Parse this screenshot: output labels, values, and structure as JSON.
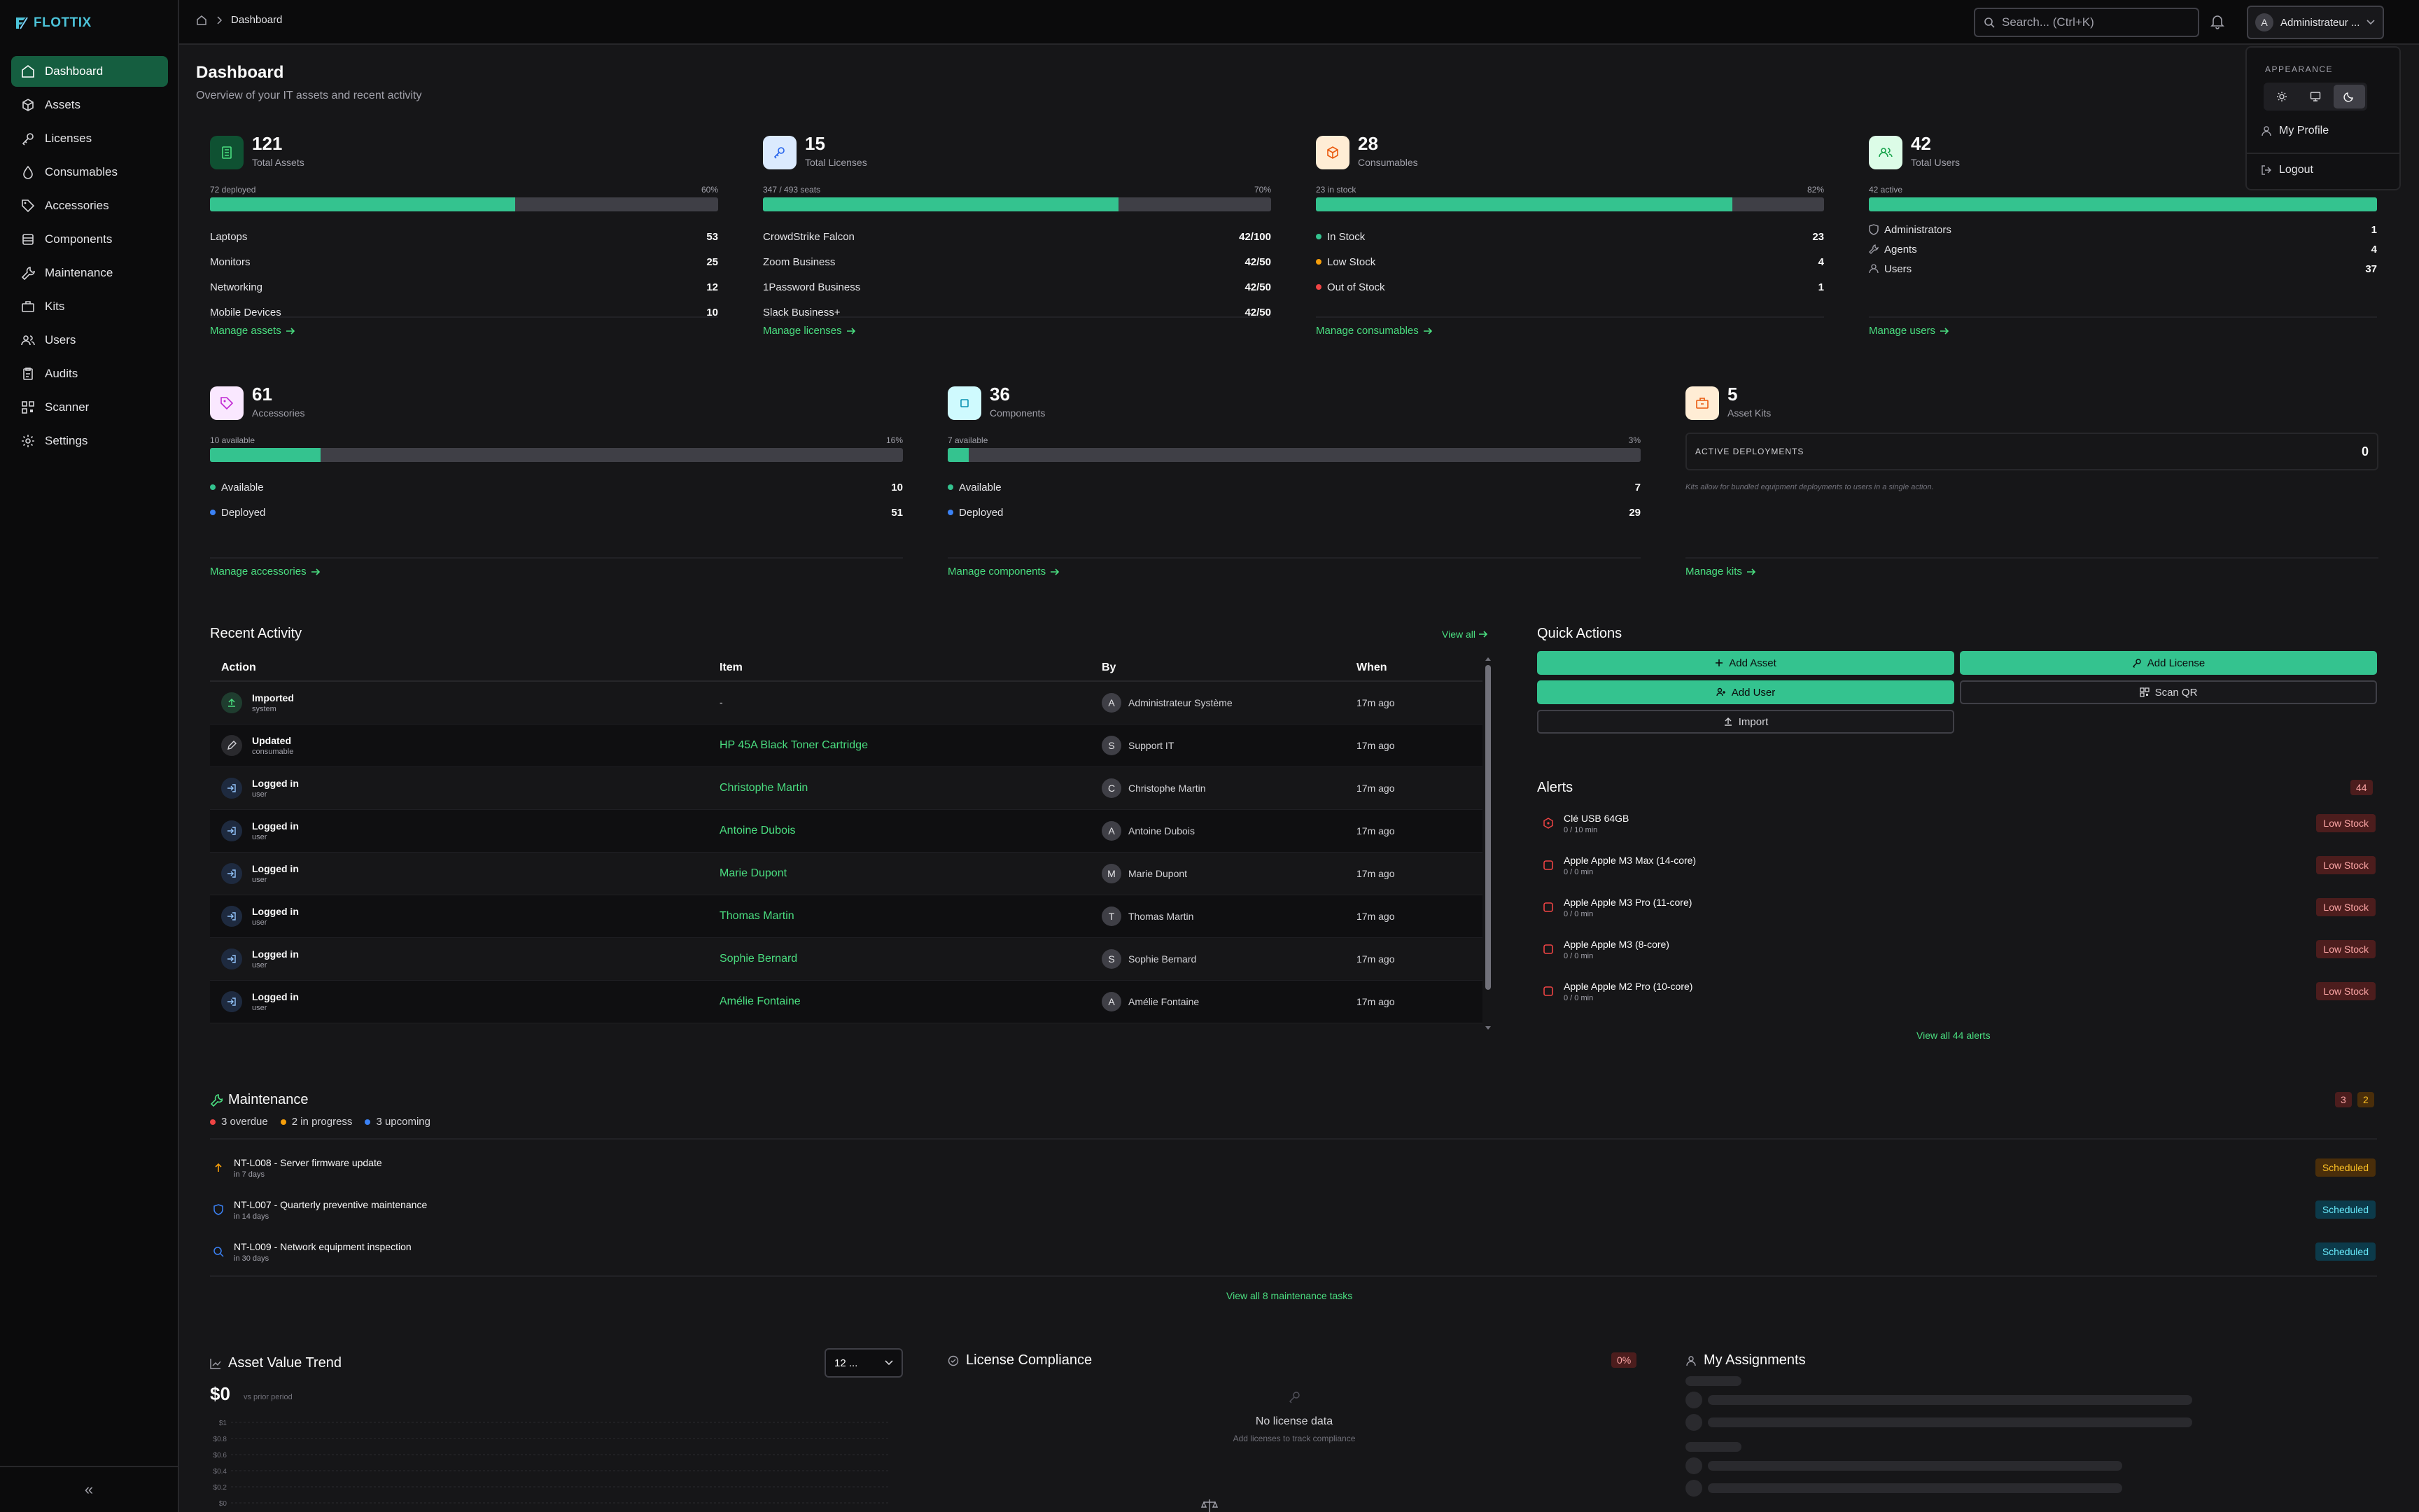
{
  "app": {
    "name": "FLOTTIX",
    "brand_color": "#34c38f",
    "accent_text": "#4ade80"
  },
  "sidebar": {
    "items": [
      {
        "label": "Dashboard",
        "icon": "home-icon",
        "active": true
      },
      {
        "label": "Assets",
        "icon": "box-icon"
      },
      {
        "label": "Licenses",
        "icon": "key-icon"
      },
      {
        "label": "Consumables",
        "icon": "droplet-icon"
      },
      {
        "label": "Accessories",
        "icon": "tag-icon"
      },
      {
        "label": "Components",
        "icon": "chip-icon"
      },
      {
        "label": "Maintenance",
        "icon": "wrench-icon"
      },
      {
        "label": "Kits",
        "icon": "kit-icon"
      },
      {
        "label": "Users",
        "icon": "users-icon"
      },
      {
        "label": "Audits",
        "icon": "clipboard-icon"
      },
      {
        "label": "Scanner",
        "icon": "scan-icon"
      },
      {
        "label": "Settings",
        "icon": "gear-icon"
      }
    ],
    "collapse_label": "«"
  },
  "topbar": {
    "breadcrumb": "Dashboard",
    "search_placeholder": "Search... (Ctrl+K)",
    "user_initial": "A",
    "user_name": "Administrateur ..."
  },
  "user_menu": {
    "appearance_label": "APPEARANCE",
    "theme_options": [
      "light",
      "system",
      "dark"
    ],
    "selected_theme": "dark",
    "profile_label": "My Profile",
    "logout_label": "Logout"
  },
  "page": {
    "title": "Dashboard",
    "subtitle": "Overview of your IT assets and recent activity"
  },
  "stats": {
    "assets": {
      "count": "121",
      "label": "Total Assets",
      "bar_left": "72 deployed",
      "bar_right": "60%",
      "fill": 0.6,
      "rows": [
        {
          "label": "Laptops",
          "value": "53"
        },
        {
          "label": "Monitors",
          "value": "25"
        },
        {
          "label": "Networking",
          "value": "12"
        },
        {
          "label": "Mobile Devices",
          "value": "10"
        }
      ],
      "link": "Manage assets"
    },
    "licenses": {
      "count": "15",
      "label": "Total Licenses",
      "bar_left": "347 / 493 seats",
      "bar_right": "70%",
      "fill": 0.7,
      "rows": [
        {
          "label": "CrowdStrike Falcon",
          "value": "42/100"
        },
        {
          "label": "Zoom Business",
          "value": "42/50"
        },
        {
          "label": "1Password Business",
          "value": "42/50"
        },
        {
          "label": "Slack Business+",
          "value": "42/50"
        }
      ],
      "link": "Manage licenses"
    },
    "consumables": {
      "count": "28",
      "label": "Consumables",
      "bar_left": "23 in stock",
      "bar_right": "82%",
      "fill": 0.82,
      "rows": [
        {
          "label": "In Stock",
          "value": "23",
          "dot": "#34c38f"
        },
        {
          "label": "Low Stock",
          "value": "4",
          "dot": "#f59e0b"
        },
        {
          "label": "Out of Stock",
          "value": "1",
          "dot": "#ef4444"
        }
      ],
      "link": "Manage consumables"
    },
    "users": {
      "count": "42",
      "label": "Total Users",
      "bar_left": "42 active",
      "bar_right": "",
      "fill": 1.0,
      "rows": [
        {
          "label": "Administrators",
          "value": "1"
        },
        {
          "label": "Agents",
          "value": "4"
        },
        {
          "label": "Users",
          "value": "37"
        }
      ],
      "link": "Manage users"
    },
    "accessories": {
      "count": "61",
      "label": "Accessories",
      "bar_left": "10 available",
      "bar_right": "16%",
      "fill": 0.16,
      "rows": [
        {
          "label": "Available",
          "value": "10",
          "dot": "#34c38f"
        },
        {
          "label": "Deployed",
          "value": "51",
          "dot": "#3b82f6"
        }
      ],
      "link": "Manage accessories"
    },
    "components": {
      "count": "36",
      "label": "Components",
      "bar_left": "7 available",
      "bar_right": "3%",
      "fill": 0.03,
      "rows": [
        {
          "label": "Available",
          "value": "7",
          "dot": "#34c38f"
        },
        {
          "label": "Deployed",
          "value": "29",
          "dot": "#3b82f6"
        }
      ],
      "link": "Manage components"
    },
    "kits": {
      "count": "5",
      "label": "Asset Kits",
      "deployments_label": "ACTIVE DEPLOYMENTS",
      "deployments_value": "0",
      "note": "Kits allow for bundled equipment deployments to users in a single action.",
      "link": "Manage kits"
    }
  },
  "activity": {
    "title": "Recent Activity",
    "view_all": "View all",
    "columns": [
      "Action",
      "Item",
      "By",
      "When"
    ],
    "rows": [
      {
        "action": "Imported",
        "type": "system",
        "item": "-",
        "item_link": false,
        "by": "Administrateur Système",
        "by_initial": "A",
        "when": "17m ago",
        "icon": "upload-icon"
      },
      {
        "action": "Updated",
        "type": "consumable",
        "item": "HP 45A Black Toner Cartridge",
        "item_link": true,
        "by": "Support IT",
        "by_initial": "S",
        "when": "17m ago",
        "icon": "pencil-icon"
      },
      {
        "action": "Logged in",
        "type": "user",
        "item": "Christophe Martin",
        "item_link": true,
        "by": "Christophe Martin",
        "by_initial": "C",
        "when": "17m ago",
        "icon": "login-icon"
      },
      {
        "action": "Logged in",
        "type": "user",
        "item": "Antoine Dubois",
        "item_link": true,
        "by": "Antoine Dubois",
        "by_initial": "A",
        "when": "17m ago",
        "icon": "login-icon"
      },
      {
        "action": "Logged in",
        "type": "user",
        "item": "Marie Dupont",
        "item_link": true,
        "by": "Marie Dupont",
        "by_initial": "M",
        "when": "17m ago",
        "icon": "login-icon"
      },
      {
        "action": "Logged in",
        "type": "user",
        "item": "Thomas Martin",
        "item_link": true,
        "by": "Thomas Martin",
        "by_initial": "T",
        "when": "17m ago",
        "icon": "login-icon"
      },
      {
        "action": "Logged in",
        "type": "user",
        "item": "Sophie Bernard",
        "item_link": true,
        "by": "Sophie Bernard",
        "by_initial": "S",
        "when": "17m ago",
        "icon": "login-icon"
      },
      {
        "action": "Logged in",
        "type": "user",
        "item": "Amélie Fontaine",
        "item_link": true,
        "by": "Amélie Fontaine",
        "by_initial": "A",
        "when": "17m ago",
        "icon": "login-icon"
      }
    ]
  },
  "quick_actions": {
    "title": "Quick Actions",
    "add_asset": "Add Asset",
    "add_license": "Add License",
    "add_user": "Add User",
    "scan_qr": "Scan QR",
    "import": "Import"
  },
  "alerts": {
    "title": "Alerts",
    "count": "44",
    "items": [
      {
        "name": "Clé USB 64GB",
        "sub": "0 / 10 min",
        "badge": "Low Stock"
      },
      {
        "name": "Apple Apple M3 Max (14-core)",
        "sub": "0 / 0 min",
        "badge": "Low Stock"
      },
      {
        "name": "Apple Apple M3 Pro (11-core)",
        "sub": "0 / 0 min",
        "badge": "Low Stock"
      },
      {
        "name": "Apple Apple M3 (8-core)",
        "sub": "0 / 0 min",
        "badge": "Low Stock"
      },
      {
        "name": "Apple Apple M2 Pro (10-core)",
        "sub": "0 / 0 min",
        "badge": "Low Stock"
      }
    ],
    "view_all": "View all 44 alerts"
  },
  "maintenance": {
    "title": "Maintenance",
    "overdue": "3 overdue",
    "in_progress": "2 in progress",
    "upcoming": "3 upcoming",
    "badge_overdue": "3",
    "badge_progress": "2",
    "items": [
      {
        "name": "NT-L008 - Server firmware update",
        "sub": "in 7 days",
        "badge": "Scheduled",
        "icon": "arrow-up-icon"
      },
      {
        "name": "NT-L007 - Quarterly preventive maintenance",
        "sub": "in 14 days",
        "badge": "Scheduled",
        "icon": "shield-icon"
      },
      {
        "name": "NT-L009 - Network equipment inspection",
        "sub": "in 30 days",
        "badge": "Scheduled",
        "icon": "search-icon"
      }
    ],
    "view_all": "View all 8 maintenance tasks"
  },
  "asset_value": {
    "title": "Asset Value Trend",
    "value": "$0",
    "compare": "vs prior period",
    "range": "12 ...",
    "y_ticks": [
      "$1",
      "$0.8",
      "$0.6",
      "$0.4",
      "$0.2",
      "$0"
    ]
  },
  "license_compliance": {
    "title": "License Compliance",
    "badge": "0%",
    "empty_title": "No license data",
    "empty_sub": "Add licenses to track compliance"
  },
  "assignments": {
    "title": "My Assignments"
  }
}
